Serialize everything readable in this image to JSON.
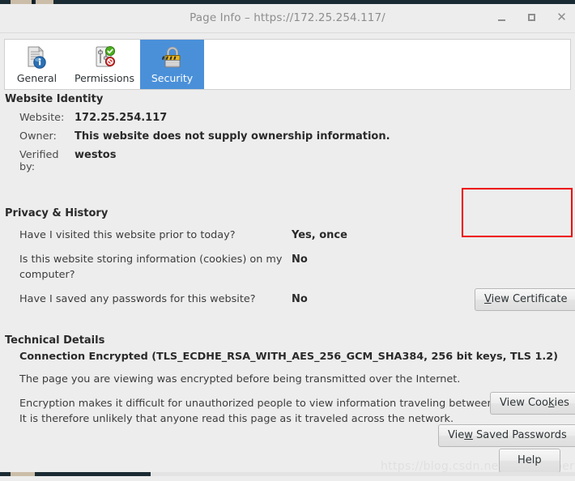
{
  "window": {
    "title": "Page Info – https://172.25.254.117/",
    "controls": {
      "minimize": "minimize-icon",
      "maximize": "maximize-icon",
      "close": "close-icon"
    }
  },
  "tabs": [
    {
      "label": "General",
      "icon": "document-info-icon",
      "selected": false
    },
    {
      "label": "Permissions",
      "icon": "sliders-permissions-icon",
      "selected": false
    },
    {
      "label": "Security",
      "icon": "padlock-icon",
      "selected": true
    }
  ],
  "website_identity": {
    "heading": "Website Identity",
    "rows": [
      {
        "label": "Website:",
        "value": "172.25.254.117"
      },
      {
        "label": "Owner:",
        "value": "This website does not supply ownership information."
      },
      {
        "label": "Verified by:",
        "value": "westos"
      }
    ],
    "view_certificate_button": {
      "prefix": "V",
      "rest": "iew Certificate",
      "highlight_color": "#ee0000"
    }
  },
  "privacy_history": {
    "heading": "Privacy & History",
    "rows": [
      {
        "question": "Have I visited this website prior to today?",
        "value": "Yes, once"
      },
      {
        "question": "Is this website storing information (cookies) on my computer?",
        "value": "No"
      },
      {
        "question": "Have I saved any passwords for this website?",
        "value": "No"
      }
    ],
    "cookies_button": {
      "pre": "View Coo",
      "mn": "k",
      "post": "ies"
    },
    "passwords_button": {
      "pre": "Vie",
      "mn": "w",
      "post": " Saved Passwords"
    }
  },
  "technical_details": {
    "heading": "Technical Details",
    "connection": "Connection Encrypted (TLS_ECDHE_RSA_WITH_AES_256_GCM_SHA384, 256 bit keys, TLS 1.2)",
    "line1": "The page you are viewing was encrypted before being transmitted over the Internet.",
    "line2": "Encryption makes it difficult for unauthorized people to view information traveling between computers.",
    "line3": "It is therefore unlikely that anyone read this page as it traveled across the network."
  },
  "footer": {
    "help_button": "Help",
    "watermark": "https://blog.csdn.net/chaos_oper"
  },
  "colors": {
    "selected_tab": "#4a90d9",
    "dialog_bg": "#ededed",
    "annotation_red": "#ee0000"
  }
}
